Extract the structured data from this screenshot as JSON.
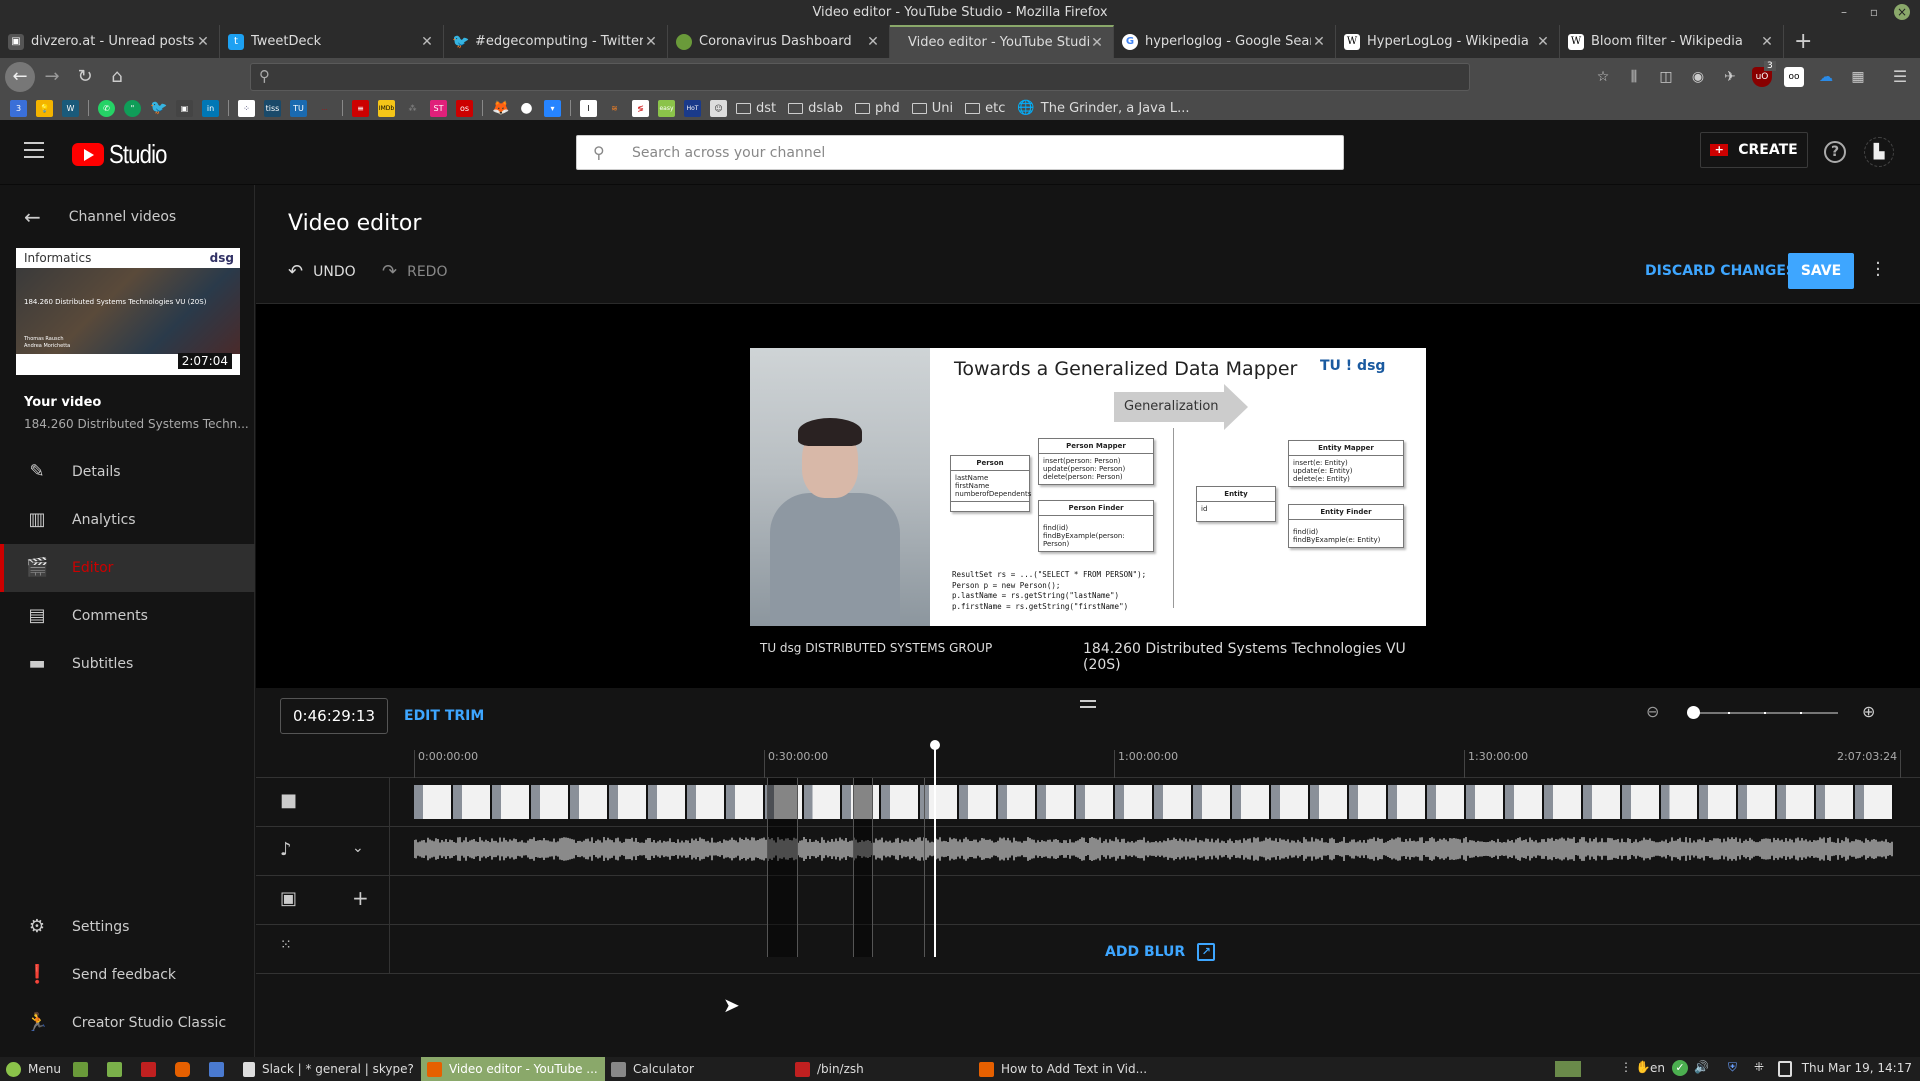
{
  "window": {
    "title": "Video editor - YouTube Studio - Mozilla Firefox"
  },
  "tabs": [
    {
      "label": "divzero.at - Unread posts",
      "icon": "divzero-icon",
      "color": "#555555"
    },
    {
      "label": "TweetDeck",
      "icon": "tweetdeck-icon",
      "color": "#1da1f2"
    },
    {
      "label": "#edgecomputing - Twitter S",
      "icon": "twitter-icon",
      "color": "#1da1f2"
    },
    {
      "label": "Coronavirus Dashboard",
      "icon": "virus-icon",
      "color": "#6a9a3a"
    },
    {
      "label": "Video editor - YouTube Studio",
      "icon": "",
      "color": "",
      "active": true
    },
    {
      "label": "hyperloglog - Google Search",
      "icon": "google-icon",
      "color": "#ffffff"
    },
    {
      "label": "HyperLogLog - Wikipedia",
      "icon": "wikipedia-icon",
      "color": "#ffffff"
    },
    {
      "label": "Bloom filter - Wikipedia",
      "icon": "wikipedia-icon",
      "color": "#ffffff"
    }
  ],
  "new_tab_label": "+",
  "urlbar": {
    "value": ""
  },
  "toolbar": {
    "ublock_badge": "3"
  },
  "bookmarks": {
    "folders": [
      "dst",
      "dslab",
      "phd",
      "Uni",
      "etc"
    ],
    "link": "The Grinder, a Java L..."
  },
  "header": {
    "logo_text": "Studio",
    "search_placeholder": "Search across your channel",
    "create_label": "CREATE",
    "help_label": "?"
  },
  "sidebar": {
    "back_label": "Channel videos",
    "thumbnail": {
      "brand": "Informatics",
      "logo": "dsg",
      "title": "184.260 Distributed Systems Technologies VU (20S)",
      "authors": [
        "Thomas Rausch",
        "Andrea Morichetta"
      ],
      "duration": "2:07:04"
    },
    "your_video_label": "Your video",
    "video_title": "184.260 Distributed Systems Techn...",
    "items": [
      {
        "label": "Details",
        "icon": "pencil-icon"
      },
      {
        "label": "Analytics",
        "icon": "analytics-icon"
      },
      {
        "label": "Editor",
        "icon": "clapperboard-icon",
        "active": true
      },
      {
        "label": "Comments",
        "icon": "comment-icon"
      },
      {
        "label": "Subtitles",
        "icon": "subtitles-icon"
      }
    ],
    "bottom_items": [
      {
        "label": "Settings",
        "icon": "gear-icon"
      },
      {
        "label": "Send feedback",
        "icon": "feedback-icon"
      },
      {
        "label": "Creator Studio Classic",
        "icon": "exit-icon"
      }
    ]
  },
  "editor": {
    "title": "Video editor",
    "undo_label": "UNDO",
    "redo_label": "REDO",
    "discard_label": "DISCARD CHANGES",
    "save_label": "SAVE"
  },
  "preview": {
    "slide_title": "Towards a Generalized Data Mapper",
    "slide_logo": "TU ! dsg",
    "generalization_label": "Generalization",
    "uml": {
      "person": {
        "name": "Person",
        "fields": [
          "lastName",
          "firstName",
          "numberofDependents"
        ]
      },
      "person_mapper": {
        "name": "Person Mapper",
        "methods": [
          "insert(person: Person)",
          "update(person: Person)",
          "delete(person: Person)"
        ]
      },
      "person_finder": {
        "name": "Person Finder",
        "methods": [
          "find(id)",
          "findByExample(person: Person)"
        ]
      },
      "entity": {
        "name": "Entity",
        "fields": [
          "id"
        ]
      },
      "entity_mapper": {
        "name": "Entity Mapper",
        "methods": [
          "insert(e: Entity)",
          "update(e: Entity)",
          "delete(e: Entity)"
        ]
      },
      "entity_finder": {
        "name": "Entity Finder",
        "methods": [
          "find(id)",
          "findByExample(e: Entity)"
        ]
      }
    },
    "code": [
      "ResultSet rs = ...(\"SELECT * FROM PERSON\");",
      "Person p = new Person();",
      "p.lastName = rs.getString(\"lastName\")",
      "p.firstName = rs.getString(\"firstName\")"
    ],
    "caption_logo": "TU  dsg  DISTRIBUTED SYSTEMS GROUP",
    "caption_text": "184.260 Distributed Systems Technologies VU (20S)"
  },
  "timeline": {
    "timecode": "0:46:29:13",
    "edit_trim_label": "EDIT TRIM",
    "zoom_level": 0,
    "ticks": [
      "0:00:00:00",
      "0:30:00:00",
      "1:00:00:00",
      "1:30:00:00",
      "2:07:03:24"
    ],
    "add_blur_label": "ADD BLUR",
    "playhead_fraction": 0.366
  },
  "taskbar": {
    "menu_label": "Menu",
    "tasks": [
      {
        "label": "Slack | * general | skype?",
        "color": "#dddddd"
      },
      {
        "label": "Video editor - YouTube ...",
        "color": "#e66000",
        "active": true
      },
      {
        "label": "Calculator",
        "color": "#888888"
      },
      {
        "label": "/bin/zsh",
        "color": "#c02020"
      },
      {
        "label": "How to Add Text in Vid...",
        "color": "#e66000"
      }
    ],
    "lang": "en",
    "clock": "Thu Mar 19, 14:17"
  }
}
